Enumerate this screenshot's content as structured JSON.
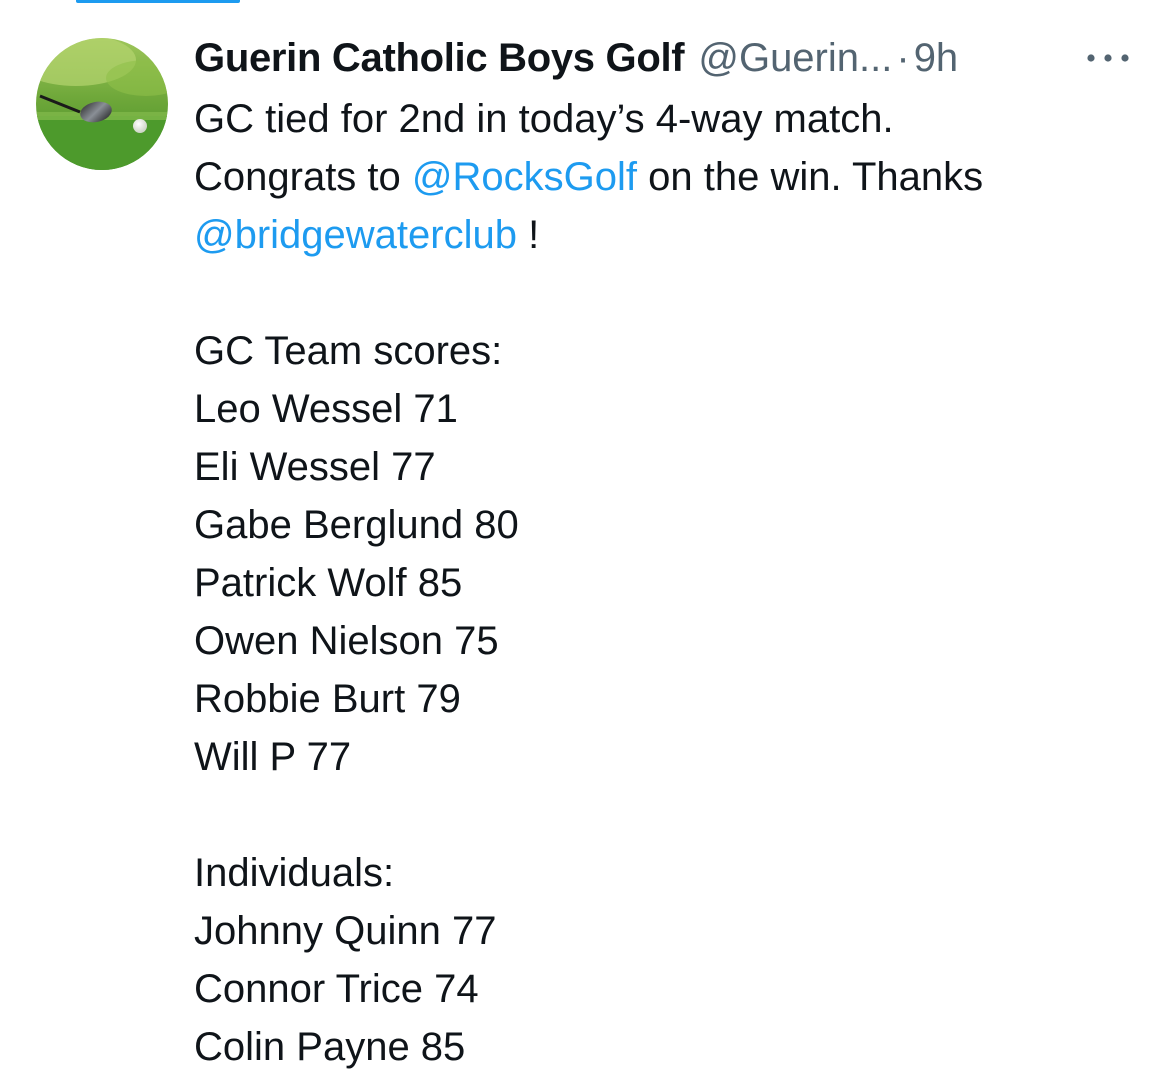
{
  "author": {
    "display_name": "Guerin Catholic Boys Golf",
    "handle": "@Guerin...",
    "separator": "·",
    "timestamp": "9h",
    "avatar_icon": "golf-club-ball-avatar"
  },
  "more_icon": "more-dots-icon",
  "colors": {
    "link": "#1d9bf0",
    "text": "#0f1419",
    "secondary": "#536471"
  },
  "tweet": {
    "intro": {
      "line1": "GC tied for 2nd in today’s 4-way match.",
      "line2_prefix": "Congrats to ",
      "mention_rocks": "@RocksGolf",
      "line2_suffix": " on the win. Thanks",
      "mention_bridgewater": "@bridgewaterclub",
      "line3_suffix": " !"
    },
    "team_heading": "GC Team scores:",
    "team_scores": [
      "Leo Wessel 71",
      "Eli Wessel 77",
      "Gabe Berglund 80",
      "Patrick Wolf 85",
      "Owen Nielson 75",
      "Robbie Burt 79",
      "Will P 77"
    ],
    "individuals_heading": "Individuals:",
    "individual_scores": [
      "Johnny Quinn 77",
      "Connor Trice 74",
      "Colin Payne 85"
    ]
  }
}
